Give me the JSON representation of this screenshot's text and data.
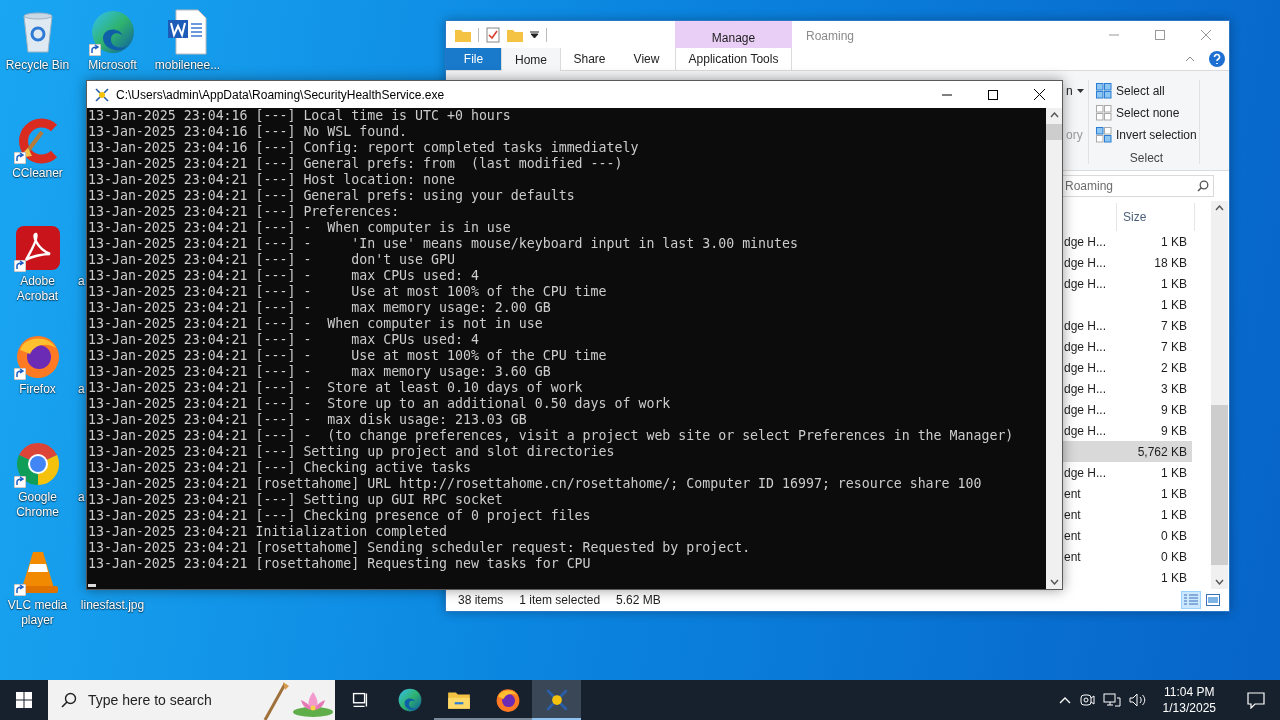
{
  "desktop": {
    "columns": [
      [
        {
          "kind": "recycle-bin",
          "label": "Recycle Bin"
        },
        {
          "kind": "ccleaner",
          "label": "CCleaner",
          "shortcut": true
        },
        {
          "kind": "acrobat",
          "label": "Adobe Acrobat",
          "shortcut": true
        },
        {
          "kind": "firefox",
          "label": "Firefox",
          "shortcut": true
        },
        {
          "kind": "chrome",
          "label": "Google Chrome",
          "shortcut": true
        },
        {
          "kind": "vlc",
          "label": "VLC media player",
          "shortcut": true
        }
      ],
      [
        {
          "kind": "edge",
          "label": "Microsoft",
          "shortcut": true
        },
        {
          "kind": "empty"
        },
        {
          "kind": "clipped",
          "label": "a"
        },
        {
          "kind": "clipped",
          "label": "a"
        },
        {
          "kind": "clipped",
          "label": "a"
        },
        {
          "kind": "covered",
          "label": "linesfast.jpg"
        }
      ],
      [
        {
          "kind": "word-document",
          "label": "mobilenee..."
        }
      ]
    ]
  },
  "explorer": {
    "title": "Roaming",
    "contextual_group": "Manage",
    "tabs": [
      {
        "label": "File",
        "kind": "file",
        "selected": false
      },
      {
        "label": "Home",
        "kind": "normal",
        "selected": true
      },
      {
        "label": "Share",
        "kind": "normal",
        "selected": false
      },
      {
        "label": "View",
        "kind": "normal",
        "selected": false
      },
      {
        "label": "Application Tools",
        "kind": "contextual",
        "selected": false
      }
    ],
    "ribbon": {
      "partial_items": [
        {
          "label": "n",
          "dropdown": true,
          "disabled": false
        },
        {
          "label": "ory",
          "disabled": true
        }
      ],
      "select_group": {
        "label": "Select",
        "items": [
          {
            "label": "Select all",
            "kind": "all"
          },
          {
            "label": "Select none",
            "kind": "none"
          },
          {
            "label": "Invert selection",
            "kind": "invert"
          }
        ]
      }
    },
    "search": {
      "placeholder": "Roaming"
    },
    "file_list": {
      "size_header": "Size",
      "rows": [
        {
          "name": "dge H...",
          "size": "1 KB",
          "selected": false
        },
        {
          "name": "dge H...",
          "size": "18 KB",
          "selected": false
        },
        {
          "name": "dge H...",
          "size": "1 KB",
          "selected": false
        },
        {
          "size": "1 KB",
          "selected": false
        },
        {
          "name": "dge H...",
          "size": "7 KB",
          "selected": false
        },
        {
          "name": "dge H...",
          "size": "7 KB",
          "selected": false
        },
        {
          "name": "dge H...",
          "size": "2 KB",
          "selected": false
        },
        {
          "name": "dge H...",
          "size": "3 KB",
          "selected": false
        },
        {
          "name": "dge H...",
          "size": "9 KB",
          "selected": false
        },
        {
          "name": "dge H...",
          "size": "9 KB",
          "selected": false
        },
        {
          "size": "5,762 KB",
          "selected": true
        },
        {
          "name": "dge H...",
          "size": "1 KB",
          "selected": false
        },
        {
          "name": "ent",
          "size": "1 KB",
          "selected": false
        },
        {
          "name": "ent",
          "size": "1 KB",
          "selected": false
        },
        {
          "name": "ent",
          "size": "0 KB",
          "selected": false
        },
        {
          "name": "ent",
          "size": "0 KB",
          "selected": false
        },
        {
          "size": "1 KB",
          "selected": false
        }
      ]
    },
    "status": [
      "38 items",
      "1 item selected",
      "5.62 MB"
    ],
    "view_buttons": [
      {
        "kind": "details",
        "selected": true
      },
      {
        "kind": "large-icons",
        "selected": false
      }
    ]
  },
  "console": {
    "title": "C:\\Users\\admin\\AppData\\Roaming\\SecurityHealthService.exe",
    "lines": [
      "13-Jan-2025 23:04:16 [---] Local time is UTC +0 hours",
      "13-Jan-2025 23:04:16 [---] No WSL found.",
      "13-Jan-2025 23:04:16 [---] Config: report completed tasks immediately",
      "13-Jan-2025 23:04:21 [---] General prefs: from  (last modified ---)",
      "13-Jan-2025 23:04:21 [---] Host location: none",
      "13-Jan-2025 23:04:21 [---] General prefs: using your defaults",
      "13-Jan-2025 23:04:21 [---] Preferences:",
      "13-Jan-2025 23:04:21 [---] -  When computer is in use",
      "13-Jan-2025 23:04:21 [---] -     'In use' means mouse/keyboard input in last 3.00 minutes",
      "13-Jan-2025 23:04:21 [---] -     don't use GPU",
      "13-Jan-2025 23:04:21 [---] -     max CPUs used: 4",
      "13-Jan-2025 23:04:21 [---] -     Use at most 100% of the CPU time",
      "13-Jan-2025 23:04:21 [---] -     max memory usage: 2.00 GB",
      "13-Jan-2025 23:04:21 [---] -  When computer is not in use",
      "13-Jan-2025 23:04:21 [---] -     max CPUs used: 4",
      "13-Jan-2025 23:04:21 [---] -     Use at most 100% of the CPU time",
      "13-Jan-2025 23:04:21 [---] -     max memory usage: 3.60 GB",
      "13-Jan-2025 23:04:21 [---] -  Store at least 0.10 days of work",
      "13-Jan-2025 23:04:21 [---] -  Store up to an additional 0.50 days of work",
      "13-Jan-2025 23:04:21 [---] -  max disk usage: 213.03 GB",
      "13-Jan-2025 23:04:21 [---] -  (to change preferences, visit a project web site or select Preferences in the Manager)",
      "13-Jan-2025 23:04:21 [---] Setting up project and slot directories",
      "13-Jan-2025 23:04:21 [---] Checking active tasks",
      "13-Jan-2025 23:04:21 [rosettahome] URL http://rosettahome.cn/rosettahome/; Computer ID 16997; resource share 100",
      "13-Jan-2025 23:04:21 [---] Setting up GUI RPC socket",
      "13-Jan-2025 23:04:21 [---] Checking presence of 0 project files",
      "13-Jan-2025 23:04:21 Initialization completed",
      "13-Jan-2025 23:04:21 [rosettahome] Sending scheduler request: Requested by project.",
      "13-Jan-2025 23:04:21 [rosettahome] Requesting new tasks for CPU"
    ]
  },
  "taskbar": {
    "search": {
      "placeholder": "Type here to search"
    },
    "apps": [
      {
        "kind": "task-view",
        "selected": false,
        "running": false
      },
      {
        "kind": "edge",
        "selected": false,
        "running": false
      },
      {
        "kind": "explorer",
        "selected": false,
        "running": true
      },
      {
        "kind": "firefox",
        "selected": false,
        "running": true
      },
      {
        "kind": "console",
        "selected": true,
        "running": true
      }
    ],
    "clock": {
      "time": "11:04 PM",
      "date": "1/13/2025"
    }
  }
}
